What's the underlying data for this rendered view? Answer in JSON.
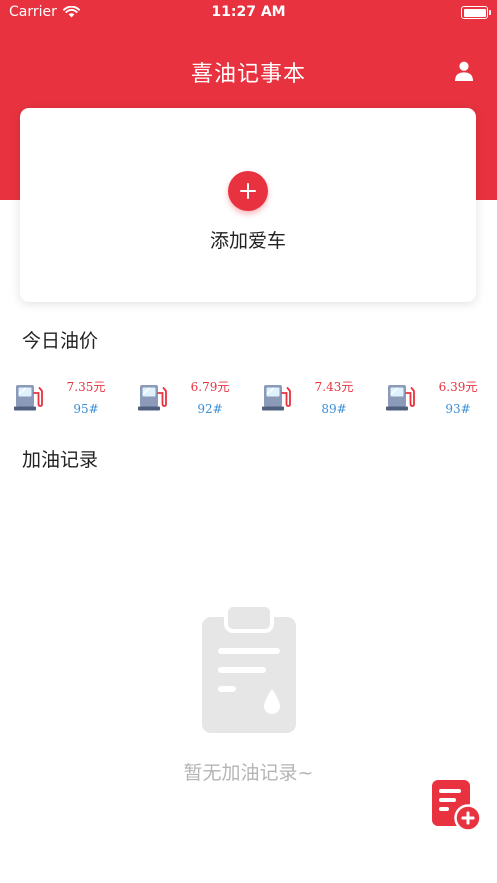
{
  "status_bar": {
    "carrier": "Carrier",
    "time": "11:27 AM"
  },
  "nav": {
    "title": "喜油记事本",
    "profile_icon": "user-icon"
  },
  "add_card": {
    "label": "添加爱车",
    "icon": "plus-icon"
  },
  "oil_price": {
    "title": "今日油价",
    "items": [
      {
        "price": "7.35元",
        "grade": "95#"
      },
      {
        "price": "6.79元",
        "grade": "92#"
      },
      {
        "price": "7.43元",
        "grade": "89#"
      },
      {
        "price": "6.39元",
        "grade": "93#"
      }
    ]
  },
  "records": {
    "title": "加油记录",
    "empty_text": "暂无加油记录~",
    "empty_icon": "clipboard-fuel-icon"
  },
  "fab": {
    "icon": "add-record-icon"
  },
  "colors": {
    "primary": "#e8323f",
    "grade_blue": "#3b8fd6",
    "empty_gray": "#e6e6e6"
  }
}
